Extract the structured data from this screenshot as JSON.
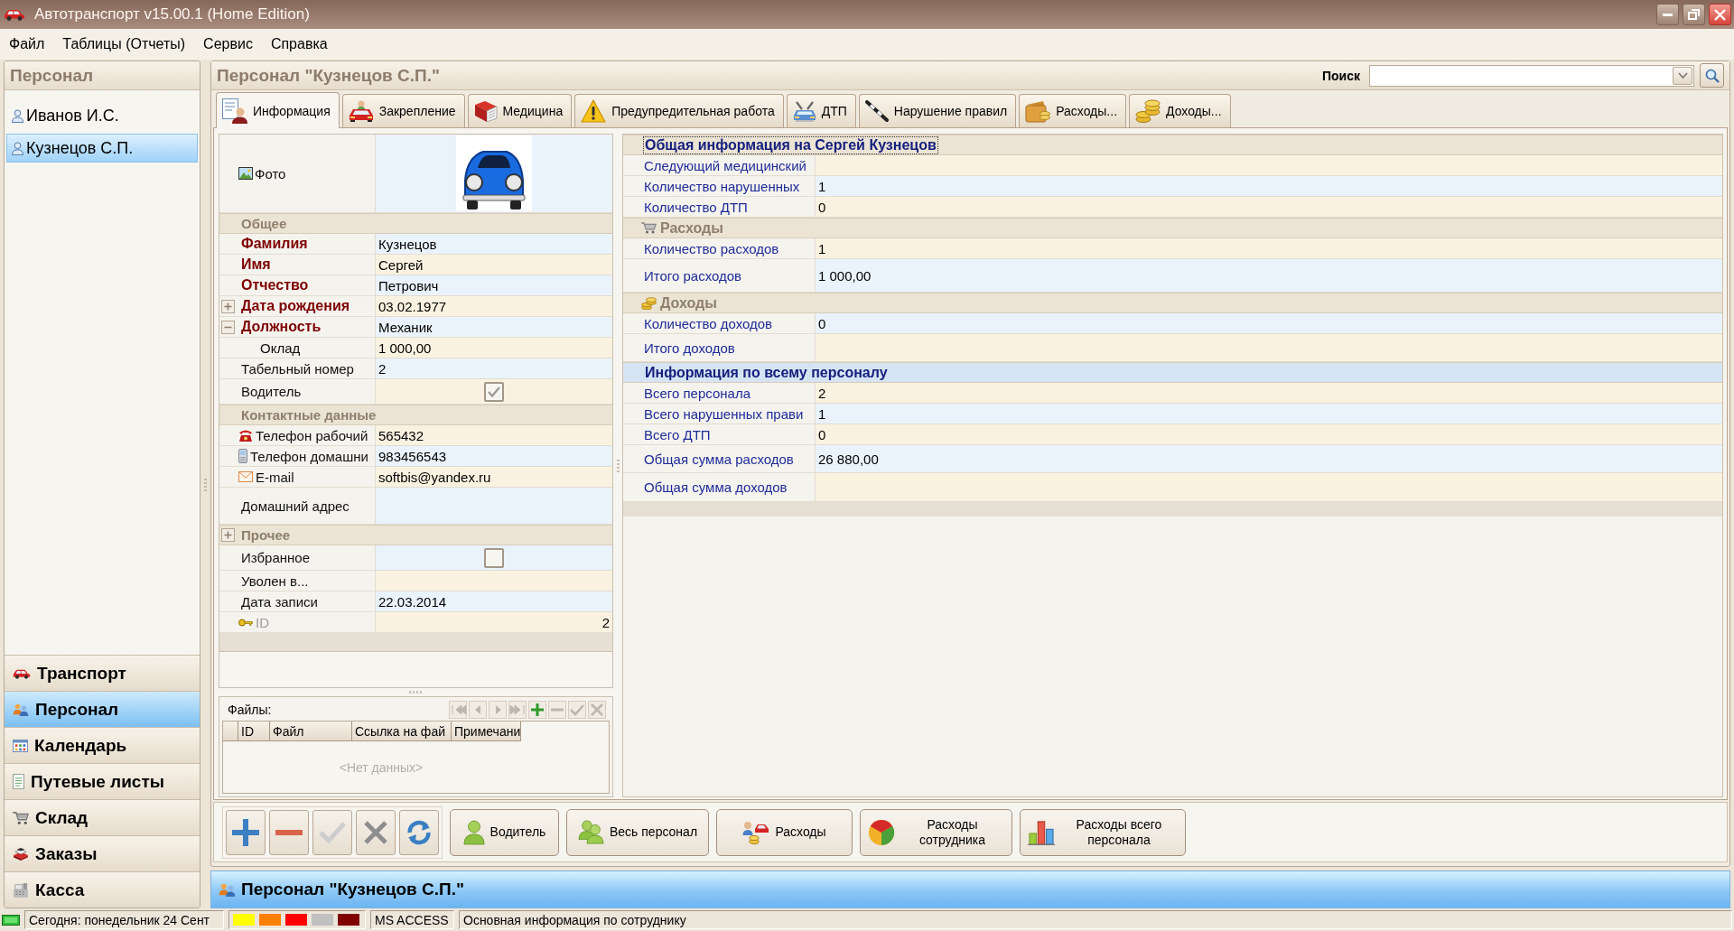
{
  "window": {
    "title": "Автотранспорт v15.00.1 (Home Edition)"
  },
  "menu": [
    {
      "label": "Файл"
    },
    {
      "label": "Таблицы (Отчеты)"
    },
    {
      "label": "Сервис"
    },
    {
      "label": "Справка"
    }
  ],
  "sidebar": {
    "title": "Персонал",
    "items": [
      {
        "label": "Иванов И.С.",
        "selected": false
      },
      {
        "label": "Кузнецов С.П.",
        "selected": true
      }
    ],
    "nav": [
      {
        "label": "Транспорт",
        "selected": false
      },
      {
        "label": "Персонал",
        "selected": true
      },
      {
        "label": "Календарь",
        "selected": false
      },
      {
        "label": "Путевые листы",
        "selected": false
      },
      {
        "label": "Склад",
        "selected": false
      },
      {
        "label": "Заказы",
        "selected": false
      },
      {
        "label": "Касса",
        "selected": false
      }
    ]
  },
  "main": {
    "title": "Персонал \"Кузнецов С.П.\"",
    "search": {
      "label": "Поиск"
    }
  },
  "tabs": [
    {
      "label": "Информация",
      "selected": true
    },
    {
      "label": "Закрепление",
      "selected": false
    },
    {
      "label": "Медицина",
      "selected": false
    },
    {
      "label": "Предупредительная работа",
      "selected": false
    },
    {
      "label": "ДТП",
      "selected": false
    },
    {
      "label": "Нарушение правил",
      "selected": false
    },
    {
      "label": "Расходы...",
      "selected": false
    },
    {
      "label": "Доходы...",
      "selected": false
    }
  ],
  "property_grid": {
    "photo_label": "Фото",
    "groups": [
      {
        "title": "Общее",
        "rows": [
          {
            "kind": "text",
            "label": "Фамилия",
            "value": "Кузнецов",
            "required": true,
            "disabled": false
          },
          {
            "kind": "text",
            "label": "Имя",
            "value": "Сергей",
            "required": true,
            "disabled": false
          },
          {
            "kind": "text",
            "label": "Отчество",
            "value": "Петрович",
            "required": true,
            "disabled": false
          },
          {
            "kind": "text",
            "label": "Дата рождения",
            "value": "03.02.1977",
            "required": true,
            "disabled": false,
            "expanded": false
          },
          {
            "kind": "text",
            "label": "Должность",
            "value": "Механик",
            "required": true,
            "disabled": false,
            "expanded": true,
            "children": [
              {
                "kind": "text",
                "label": "Оклад",
                "value": "1 000,00",
                "required": false,
                "disabled": false
              }
            ]
          },
          {
            "kind": "text",
            "label": "Табельный номер",
            "value": "2",
            "required": false,
            "disabled": false
          },
          {
            "kind": "checkbox",
            "label": "Водитель",
            "checked": true,
            "required": false,
            "disabled": false
          }
        ]
      },
      {
        "title": "Контактные данные",
        "rows": [
          {
            "kind": "text",
            "label": "Телефон рабочий",
            "value": "565432",
            "required": false,
            "disabled": false
          },
          {
            "kind": "text",
            "label": "Телефон домашни",
            "value": "983456543",
            "required": false,
            "disabled": false
          },
          {
            "kind": "text",
            "label": "E-mail",
            "value": "softbis@yandex.ru",
            "required": false,
            "disabled": false
          },
          {
            "kind": "text",
            "label": "Домашний адрес",
            "required": false,
            "disabled": false
          }
        ]
      },
      {
        "title": "Прочее",
        "expanded": false,
        "rows": [
          {
            "kind": "checkbox",
            "label": "Избранное",
            "checked": false,
            "required": false,
            "disabled": false
          },
          {
            "kind": "text",
            "label": "Уволен в...",
            "required": false,
            "disabled": false
          },
          {
            "kind": "text",
            "label": "Дата записи",
            "value": "22.03.2014",
            "required": false,
            "disabled": false
          },
          {
            "kind": "text",
            "label": "ID",
            "value": "2",
            "required": false,
            "disabled": true
          }
        ]
      }
    ]
  },
  "files": {
    "label": "Файлы:",
    "nav_tools": [
      {
        "disabled": true
      },
      {
        "disabled": true
      },
      {
        "disabled": true
      },
      {
        "disabled": true
      },
      {
        "disabled": false
      },
      {
        "disabled": true
      },
      {
        "disabled": true
      },
      {
        "disabled": true
      }
    ],
    "columns": [
      "ID",
      "Файл",
      "Ссылка на фай",
      "Примечани"
    ],
    "empty_text": "<Нет данных>"
  },
  "info_panel": {
    "sections": [
      {
        "kind": "title",
        "title": "Общая информация на Сергей Кузнецов",
        "focused": true,
        "rows": [
          {
            "label": "Следующий медицинский"
          },
          {
            "label": "Количество нарушенных",
            "value": "1"
          },
          {
            "label": "Количество ДТП",
            "value": "0"
          }
        ]
      },
      {
        "kind": "group",
        "title": "Расходы",
        "focused": false,
        "rows": [
          {
            "label": "Количество расходов",
            "value": "1"
          },
          {
            "label": "Итого расходов",
            "value": "1 000,00"
          }
        ]
      },
      {
        "kind": "group",
        "title": "Доходы",
        "focused": false,
        "rows": [
          {
            "label": "Количество доходов",
            "value": "0"
          },
          {
            "label": "Итого доходов"
          }
        ]
      },
      {
        "kind": "highlight",
        "title": "Информация по всему персоналу",
        "focused": false,
        "rows": [
          {
            "label": "Всего персонала",
            "value": "2"
          },
          {
            "label": "Всего нарушенных прави",
            "value": "1"
          },
          {
            "label": "Всего ДТП",
            "value": "0"
          },
          {
            "label": "Общая сумма расходов",
            "value": "26 880,00"
          },
          {
            "label": "Общая сумма доходов"
          }
        ]
      }
    ]
  },
  "toolbar": {
    "tools": [
      {
        "disabled": false
      },
      {
        "disabled": false
      },
      {
        "disabled": true
      },
      {
        "disabled": true
      },
      {
        "disabled": false
      }
    ],
    "buttons": [
      {
        "label": "Водитель"
      },
      {
        "label": "Весь персонал"
      },
      {
        "label": "Расходы"
      },
      {
        "label": "Расходы сотрудника"
      },
      {
        "label": "Расходы всего персонала"
      }
    ]
  },
  "footer": {
    "title": "Персонал \"Кузнецов С.П.\""
  },
  "status_bar": {
    "date": "Сегодня: понедельник 24 Сент",
    "swatches": [
      {
        "color": "#ffff00"
      },
      {
        "color": "#ff8000"
      },
      {
        "color": "#ff0000"
      },
      {
        "color": "#c0c0c0"
      },
      {
        "color": "#800000"
      }
    ],
    "database": "MS ACCESS",
    "message": "Основная информация по сотруднику"
  }
}
